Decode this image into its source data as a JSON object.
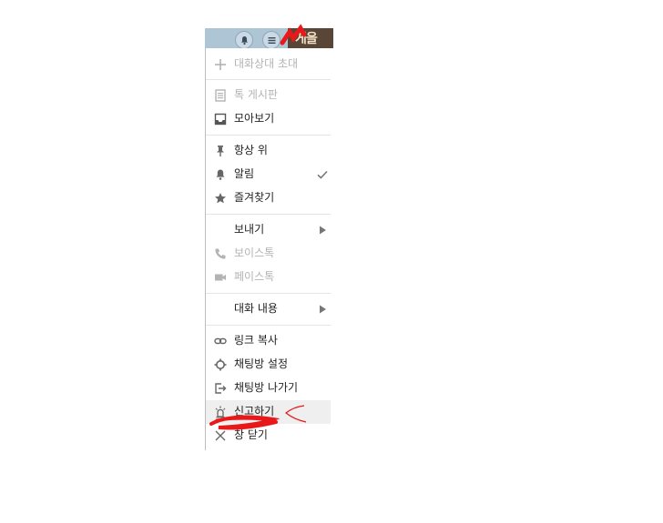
{
  "header": {
    "notification_button": "bell-icon",
    "menu_button": "hamburger-icon",
    "badge_text": "게을"
  },
  "menu": {
    "invite": "대화상대 초대",
    "board": "톡 게시판",
    "gallery": "모아보기",
    "always_on_top": "항상 위",
    "notifications": "알림",
    "favorites": "즐겨찾기",
    "send": "보내기",
    "voice_talk": "보이스톡",
    "face_talk": "페이스톡",
    "chat_content": "대화 내용",
    "copy_link": "링크 복사",
    "room_settings": "채팅방 설정",
    "leave_room": "채팅방 나가기",
    "report": "신고하기",
    "close_window": "창 닫기"
  },
  "state": {
    "notifications_checked": true,
    "highlighted_item": "report"
  },
  "colors": {
    "header_bg": "#aec5d6",
    "menu_text": "#222222",
    "disabled_text": "#b3b3b3",
    "highlight_bg": "#efefef",
    "annotation_red": "#e8191b"
  }
}
